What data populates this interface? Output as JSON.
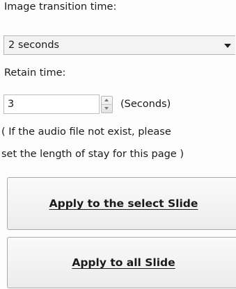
{
  "transition": {
    "label": "Image transition time:",
    "selected": "2 seconds"
  },
  "retain": {
    "label": "Retain time:",
    "value": "3",
    "unit": "(Seconds)"
  },
  "note": {
    "line1": "( If the audio file not exist, please",
    "line2": "set the length of stay for this page )"
  },
  "buttons": {
    "apply_selected": "Apply to the select Slide",
    "apply_all": "Apply to all Slide"
  }
}
